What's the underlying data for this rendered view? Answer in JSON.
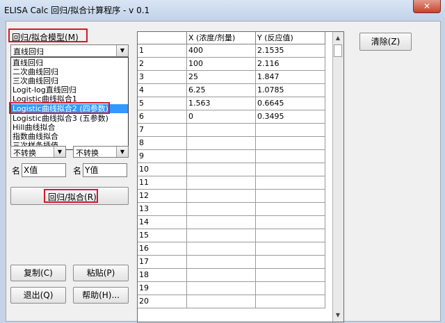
{
  "window": {
    "title": "ELISA Calc 回归/拟合计算程序 - v 0.1",
    "close_glyph": "✕"
  },
  "left": {
    "model_label": "回归/拟合模型(M)",
    "model_selected": "直线回归",
    "dropdown_items": [
      "直线回归",
      "二次曲线回归",
      "三次曲线回归",
      "Logit-log直线回归",
      "Logistic曲线拟合1",
      "Logistic曲线拟合2 (四参数)",
      "Logistic曲线拟合3 (五参数)",
      "Hill曲线拟合",
      "指数曲线拟合",
      "三次样条插值"
    ],
    "selected_index": 5,
    "transform_x": "不转换",
    "transform_y": "不转换",
    "name_label_x": "名",
    "name_x_value": "X值",
    "name_label_y": "名",
    "name_y_value": "Y值",
    "fit_button": "回归/拟合(R)",
    "copy_button": "复制(C)",
    "paste_button": "粘贴(P)",
    "exit_button": "退出(Q)",
    "help_button": "帮助(H)..."
  },
  "grid": {
    "col_x_header": "X (浓度/剂量)",
    "col_y_header": "Y (反应值)",
    "rows": [
      {
        "n": "1",
        "x": "400",
        "y": "2.1535"
      },
      {
        "n": "2",
        "x": "100",
        "y": "2.116"
      },
      {
        "n": "3",
        "x": "25",
        "y": "1.847"
      },
      {
        "n": "4",
        "x": "6.25",
        "y": "1.0785"
      },
      {
        "n": "5",
        "x": "1.563",
        "y": "0.6645"
      },
      {
        "n": "6",
        "x": "0",
        "y": "0.3495"
      },
      {
        "n": "7",
        "x": "",
        "y": ""
      },
      {
        "n": "8",
        "x": "",
        "y": ""
      },
      {
        "n": "9",
        "x": "",
        "y": ""
      },
      {
        "n": "10",
        "x": "",
        "y": ""
      },
      {
        "n": "11",
        "x": "",
        "y": ""
      },
      {
        "n": "12",
        "x": "",
        "y": ""
      },
      {
        "n": "13",
        "x": "",
        "y": ""
      },
      {
        "n": "14",
        "x": "",
        "y": ""
      },
      {
        "n": "15",
        "x": "",
        "y": ""
      },
      {
        "n": "16",
        "x": "",
        "y": ""
      },
      {
        "n": "17",
        "x": "",
        "y": ""
      },
      {
        "n": "18",
        "x": "",
        "y": ""
      },
      {
        "n": "19",
        "x": "",
        "y": ""
      },
      {
        "n": "20",
        "x": "",
        "y": ""
      }
    ]
  },
  "right": {
    "clear_button": "清除(Z)"
  },
  "colors": {
    "highlight": "#3399ff",
    "annotation_red": "#d11a2a"
  }
}
